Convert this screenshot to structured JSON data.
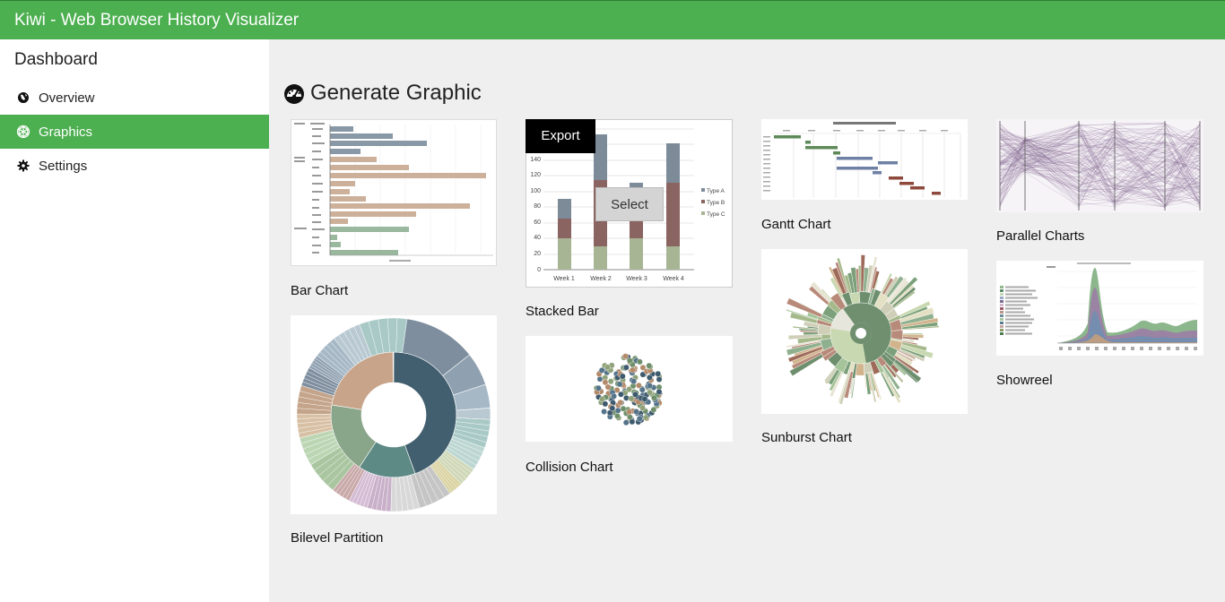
{
  "app": {
    "title": "Kiwi - Web Browser History Visualizer"
  },
  "sidebar": {
    "heading": "Dashboard",
    "items": [
      {
        "label": "Overview",
        "icon": "globe-icon"
      },
      {
        "label": "Graphics",
        "icon": "graphics-icon",
        "active": true
      },
      {
        "label": "Settings",
        "icon": "gear-icon"
      }
    ]
  },
  "main": {
    "heading": "Generate Graphic",
    "heading_icon": "dashboard-icon"
  },
  "cards": [
    {
      "label": "Bar Chart"
    },
    {
      "label": "Stacked Bar",
      "overlay": {
        "export": "Export",
        "select": "Select"
      }
    },
    {
      "label": "Gantt Chart"
    },
    {
      "label": "Parallel Charts"
    },
    {
      "label": "Bilevel Partition"
    },
    {
      "label": "Collision Chart"
    },
    {
      "label": "Sunburst Chart"
    },
    {
      "label": "Showreel"
    }
  ],
  "colors": {
    "accent": "#4caf50",
    "header_text": "#ffffff"
  }
}
